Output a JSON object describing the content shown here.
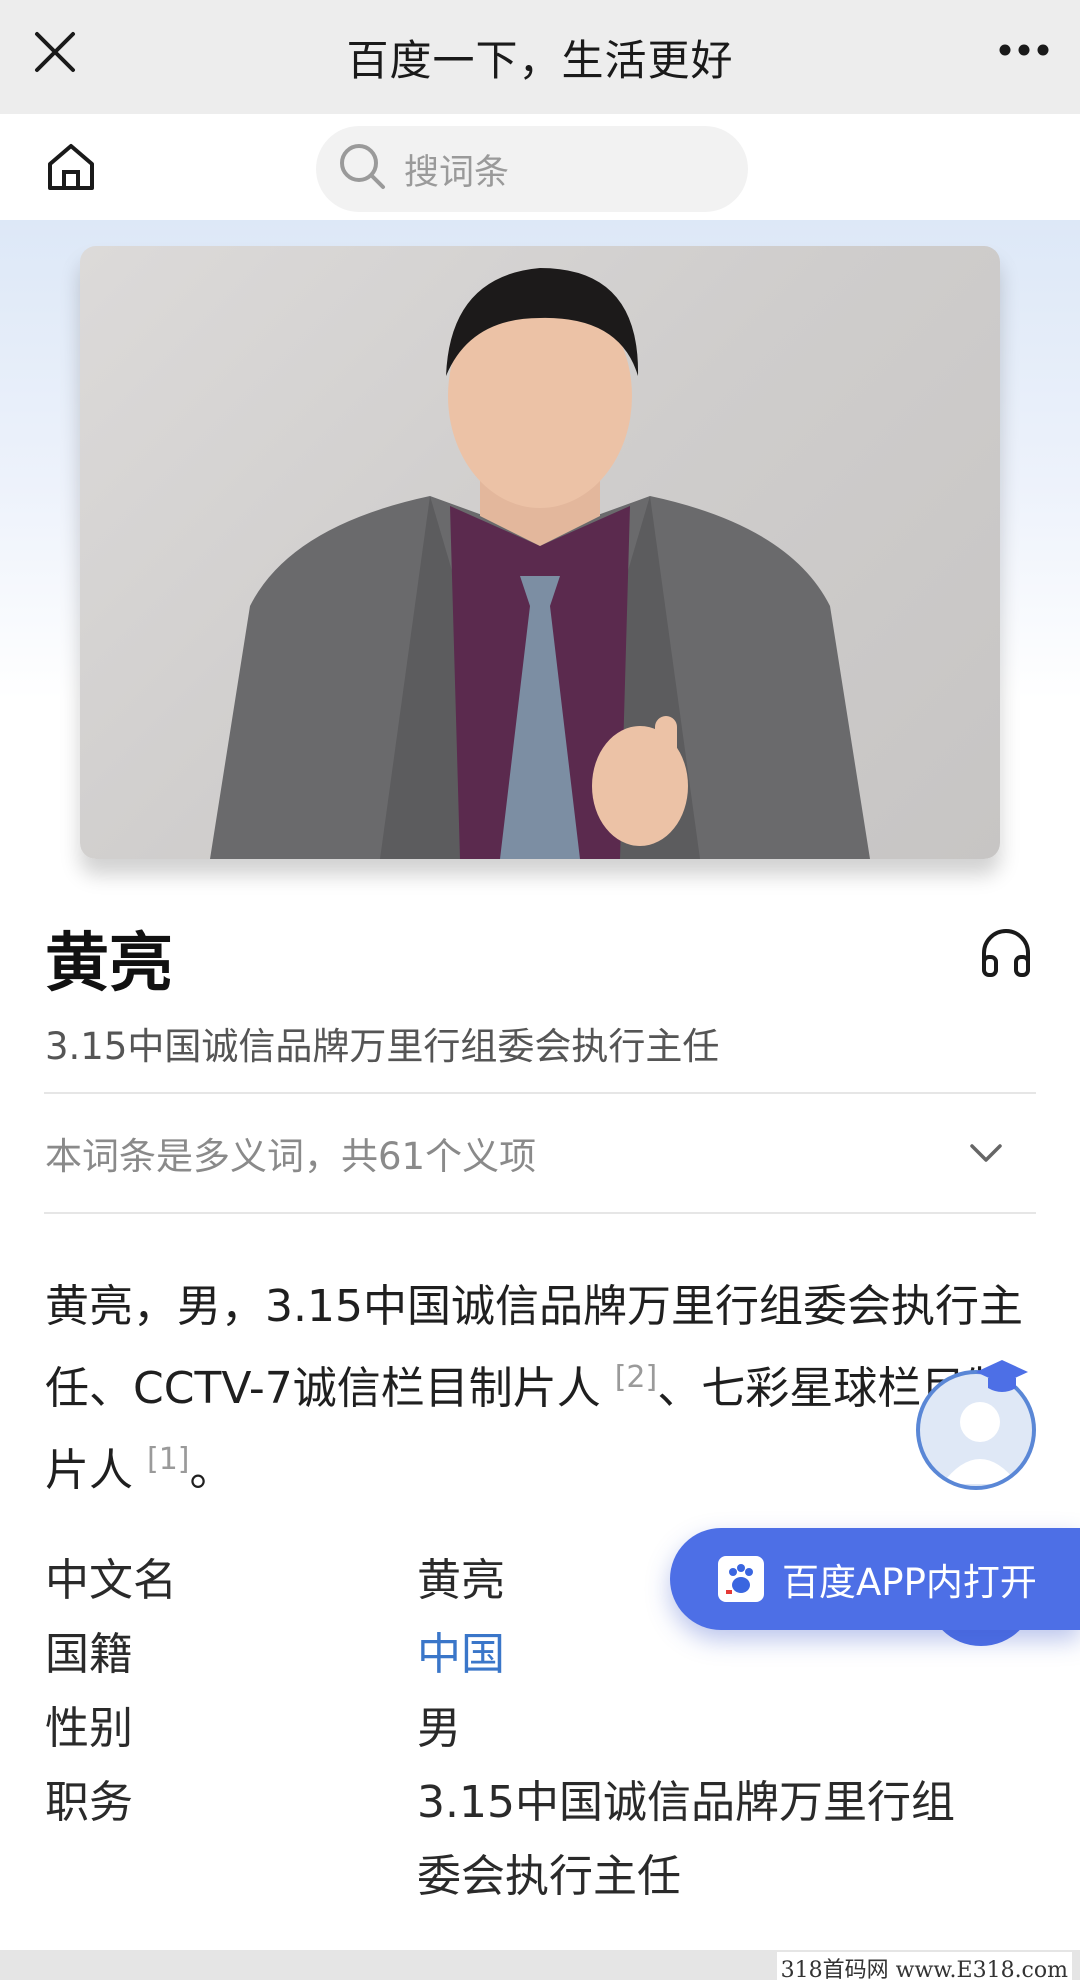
{
  "topbar": {
    "title": "百度一下，生活更好",
    "close_icon": "close-icon",
    "more_icon": "more-dots-icon"
  },
  "search": {
    "home_icon": "home-icon",
    "placeholder": "搜词条"
  },
  "entry": {
    "name": "黄亮",
    "subtitle": "3.15中国诚信品牌万里行组委会执行主任",
    "polysemy_note": "本词条是多义词，共61个义项",
    "summary": {
      "part1": "黄亮，男，3.15中国诚信品牌万里行组委会执行主任、CCTV-7诚信栏目制片人",
      "ref1": "[2]",
      "part2": "、七彩星球栏目制片人",
      "ref2": "[1]",
      "part3": "。"
    },
    "info": [
      {
        "key": "中文名",
        "value": "黄亮",
        "link": false
      },
      {
        "key": "国籍",
        "value": "中国",
        "link": true
      },
      {
        "key": "性别",
        "value": "男",
        "link": false
      },
      {
        "key": "职务",
        "value": "3.15中国诚信品牌万里行组委会执行主任",
        "link": false
      }
    ]
  },
  "floating": {
    "open_app_label": "百度APP内打开",
    "open_app_icon": "baidu-paw-icon",
    "assistant_icon": "assistant-avatar-icon"
  },
  "colors": {
    "accent": "#4d6fe6",
    "link": "#3a76c9"
  },
  "watermark": "318首码网 www.E318.com"
}
